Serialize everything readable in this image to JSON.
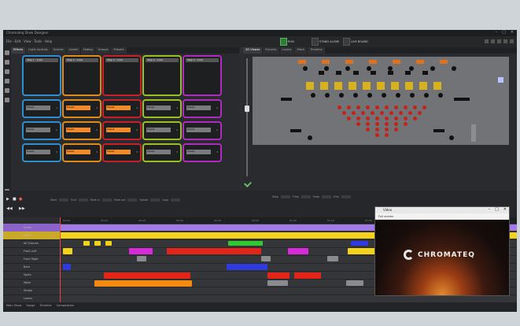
{
  "window": {
    "title": "Chromateq Show Designer",
    "minimize": "–",
    "maximize": "□",
    "close": "✕"
  },
  "toolbar": {
    "menu": "File  ·  Edit  ·  View  ·  Tools  ·  Help",
    "btn_a": "RUN",
    "btn_b": "STAND ALONE",
    "btn_c": "LIVE BOARD"
  },
  "left_tabs": [
    "Effects",
    "Light controls",
    "Scenes",
    "Levels",
    "Fading",
    "Groups",
    "Presets"
  ],
  "right_tabs": [
    "2D Viewer",
    "Fixtures",
    "Layers",
    "Patch",
    "Timeline"
  ],
  "pads": [
    {
      "color": "#2f8ed0",
      "big": "Step 1 - Color",
      "rows": [
        {
          "label": "Preset",
          "num": "1"
        },
        {
          "label": "Preset",
          "num": "2"
        },
        {
          "label": "Preset",
          "num": "3"
        }
      ]
    },
    {
      "color": "#e08a1a",
      "big": "Step 2 - Color",
      "rows": [
        {
          "label": "Preset",
          "num": "1"
        },
        {
          "label": "Preset",
          "num": "2"
        },
        {
          "label": "Preset",
          "num": "3"
        }
      ]
    },
    {
      "color": "#c8202a",
      "big": "Step 3 - Color",
      "rows": [
        {
          "label": "Preset",
          "num": "1"
        },
        {
          "label": "Preset",
          "num": "2"
        },
        {
          "label": "Preset",
          "num": "3"
        }
      ]
    },
    {
      "color": "#9ac020",
      "big": "Step 4 - Color",
      "rows": [
        {
          "label": "Preset",
          "num": "1"
        },
        {
          "label": "Preset",
          "num": "2"
        },
        {
          "label": "Preset",
          "num": "3"
        }
      ]
    },
    {
      "color": "#b02ac0",
      "big": "Step 5 - Color",
      "rows": [
        {
          "label": "Preset",
          "num": "1"
        },
        {
          "label": "Preset",
          "num": "2"
        },
        {
          "label": "Preset",
          "num": "3"
        }
      ]
    }
  ],
  "transport": {
    "play": "▶",
    "stop": "■",
    "rec": "●",
    "rewind": "◀◀",
    "forward": "▶▶",
    "param_labels": [
      "Start",
      "End",
      "Fade in",
      "Fade out",
      "Speed",
      "Loop"
    ],
    "right_labels": [
      "Step",
      "Time",
      "Fade",
      "Dim"
    ]
  },
  "ruler": [
    "00:00",
    "00:10",
    "00:20",
    "00:30",
    "00:40",
    "00:50",
    "01:00",
    "01:10",
    "01:20",
    "01:30",
    "01:40",
    "01:50"
  ],
  "tracks": [
    "Audio",
    "Video",
    "All Fixtures",
    "Front Left",
    "Front Right",
    "Back",
    "Spots",
    "Wash",
    "Strobe",
    "Lasers"
  ],
  "bottom_tabs": [
    "Main Show",
    "Songs",
    "Timeline",
    "Composition"
  ],
  "bottom_status": "Ready",
  "preview": {
    "title": "Video",
    "menu": "Full screen",
    "logo_text": "CHROMATEQ"
  },
  "colors": {
    "yellow": "#f2d21a",
    "purple": "#a27ae8",
    "red": "#e32418",
    "magenta": "#d82ad8",
    "blue": "#2f3be0",
    "orange": "#f48a10",
    "green": "#32c832"
  }
}
